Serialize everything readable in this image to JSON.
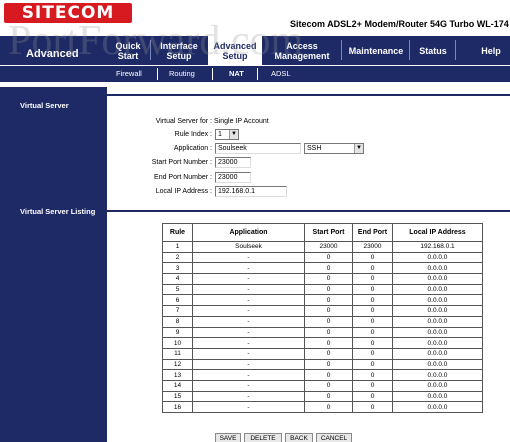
{
  "header": {
    "logo": "SITECOM",
    "product": "Sitecom ADSL2+ Modem/Router 54G Turbo WL-174",
    "watermark": "PortForward.com"
  },
  "nav": {
    "brand": "Advanced",
    "items": [
      {
        "l1": "Quick",
        "l2": "Start"
      },
      {
        "l1": "Interface",
        "l2": "Setup"
      },
      {
        "l1": "Advanced",
        "l2": "Setup"
      },
      {
        "l1": "Access",
        "l2": "Management"
      },
      {
        "l1": "Maintenance",
        "l2": ""
      },
      {
        "l1": "Status",
        "l2": ""
      },
      {
        "l1": "Help",
        "l2": ""
      }
    ],
    "subitems": [
      "Firewall",
      "Routing",
      "NAT",
      "ADSL"
    ]
  },
  "sections": {
    "virtual_server": "Virtual Server",
    "listing": "Virtual Server Listing"
  },
  "form": {
    "vs_for_label": "Virtual Server for :",
    "vs_for_value": "Single IP Account",
    "rule_index_label": "Rule Index :",
    "rule_index_value": "1",
    "application_label": "Application :",
    "application_value": "Soulseek",
    "application_select": "SSH",
    "start_port_label": "Start Port Number :",
    "start_port_value": "23000",
    "end_port_label": "End Port Number :",
    "end_port_value": "23000",
    "local_ip_label": "Local IP Address :",
    "local_ip_value": "192.168.0.1"
  },
  "table": {
    "headers": [
      "Rule",
      "Application",
      "Start Port",
      "End Port",
      "Local IP Address"
    ],
    "rows": [
      [
        "1",
        "Soulseek",
        "23000",
        "23000",
        "192.168.0.1"
      ],
      [
        "2",
        "-",
        "0",
        "0",
        "0.0.0.0"
      ],
      [
        "3",
        "-",
        "0",
        "0",
        "0.0.0.0"
      ],
      [
        "4",
        "-",
        "0",
        "0",
        "0.0.0.0"
      ],
      [
        "5",
        "-",
        "0",
        "0",
        "0.0.0.0"
      ],
      [
        "6",
        "-",
        "0",
        "0",
        "0.0.0.0"
      ],
      [
        "7",
        "-",
        "0",
        "0",
        "0.0.0.0"
      ],
      [
        "8",
        "-",
        "0",
        "0",
        "0.0.0.0"
      ],
      [
        "9",
        "-",
        "0",
        "0",
        "0.0.0.0"
      ],
      [
        "10",
        "-",
        "0",
        "0",
        "0.0.0.0"
      ],
      [
        "11",
        "-",
        "0",
        "0",
        "0.0.0.0"
      ],
      [
        "12",
        "-",
        "0",
        "0",
        "0.0.0.0"
      ],
      [
        "13",
        "-",
        "0",
        "0",
        "0.0.0.0"
      ],
      [
        "14",
        "-",
        "0",
        "0",
        "0.0.0.0"
      ],
      [
        "15",
        "-",
        "0",
        "0",
        "0.0.0.0"
      ],
      [
        "16",
        "-",
        "0",
        "0",
        "0.0.0.0"
      ]
    ]
  },
  "buttons": {
    "save": "SAVE",
    "delete": "DELETE",
    "back": "BACK",
    "cancel": "CANCEL"
  },
  "colors": {
    "nav_bg": "#1e2a66",
    "logo_bg": "#d71920"
  }
}
